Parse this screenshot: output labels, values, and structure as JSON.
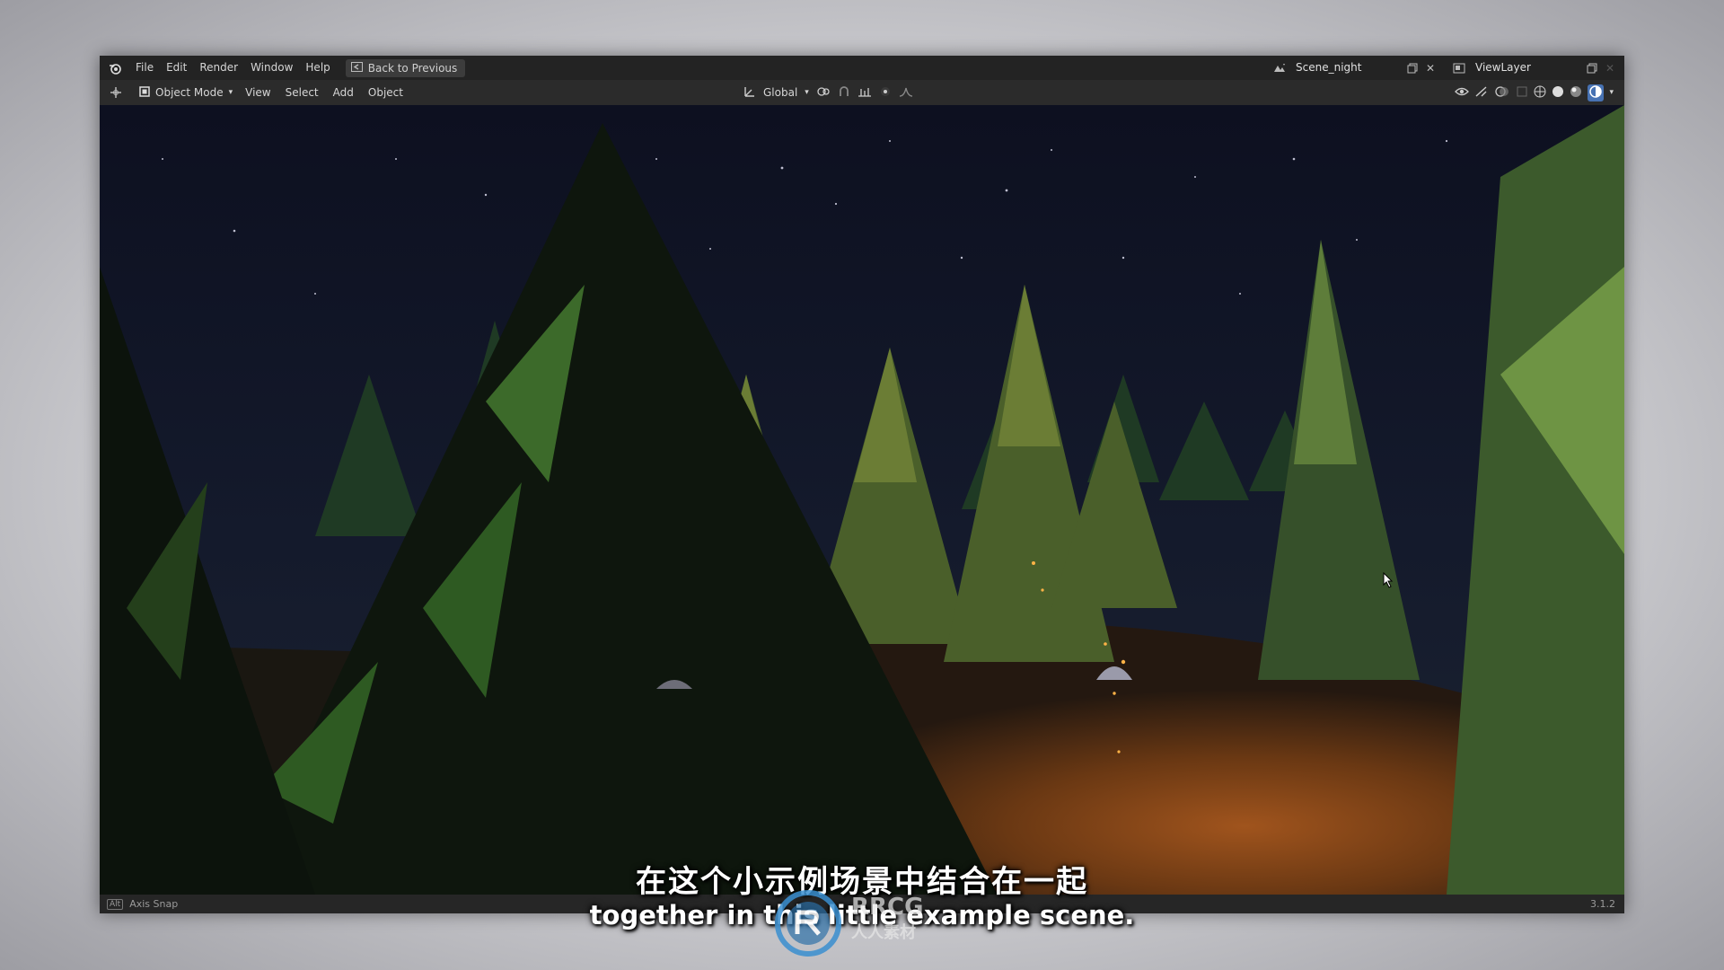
{
  "topbar": {
    "menu": [
      "File",
      "Edit",
      "Render",
      "Window",
      "Help"
    ],
    "back_button": "Back to Previous",
    "scene_name": "Scene_night",
    "view_layer": "ViewLayer"
  },
  "toolbar": {
    "mode": "Object Mode",
    "menu": [
      "View",
      "Select",
      "Add",
      "Object"
    ],
    "transform_orientation": "Global"
  },
  "statusbar": {
    "key_hint": "Alt",
    "hint_label": "Axis Snap",
    "version": "3.1.2"
  },
  "subtitles": {
    "chinese": "在这个小示例场景中结合在一起",
    "english": "together in this little example scene."
  },
  "watermark": {
    "brand": "RRCG",
    "chinese": "人人素材"
  },
  "icons": {
    "app": "blender-logo-icon",
    "colors": {
      "ui_bg": "#232323",
      "accent": "#4772b3"
    }
  }
}
